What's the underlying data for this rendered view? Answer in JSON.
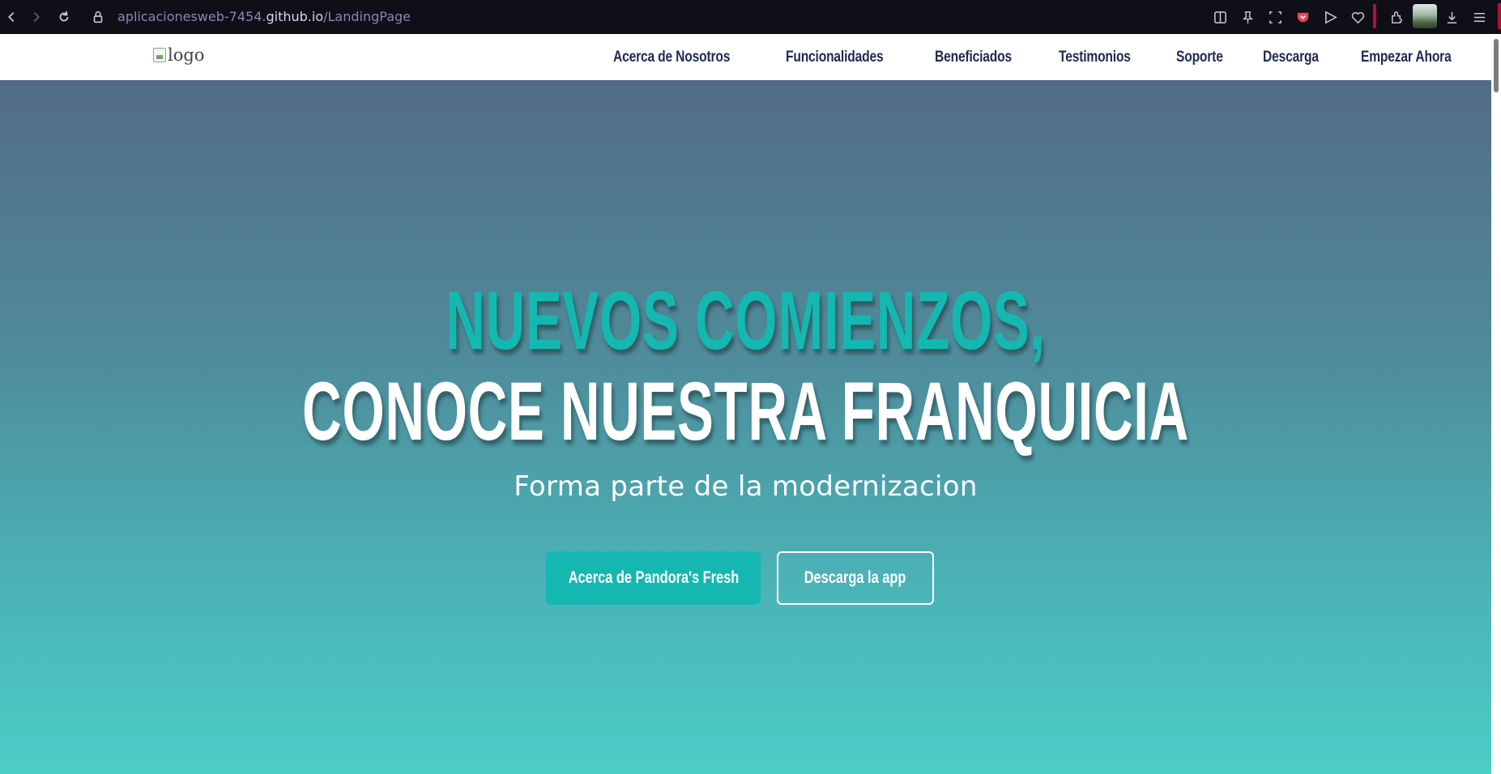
{
  "browser": {
    "url_prefix": "aplicacionesweb-7454.",
    "url_host": "github.io",
    "url_path": "/LandingPage"
  },
  "header": {
    "logo_alt": "logo",
    "nav": [
      "Acerca de Nosotros",
      "Funcionalidades",
      "Beneficiados",
      "Testimonios",
      "Soporte",
      "Descarga",
      "Empezar Ahora"
    ]
  },
  "hero": {
    "line1": "NUEVOS COMIENZOS,",
    "line2": "CONOCE NUESTRA FRANQUICIA",
    "subtitle": "Forma parte de la modernizacion",
    "primary_button": "Acerca de Pandora's Fresh",
    "secondary_button": "Descarga la app"
  },
  "colors": {
    "accent": "#14b8b1",
    "nav_text": "#1e2a52",
    "hero_top": "#536b87",
    "hero_bottom": "#4bcdc6"
  },
  "icons": [
    "back-icon",
    "forward-icon",
    "reload-icon",
    "lock-icon",
    "split-view-icon",
    "pin-icon",
    "screenshot-icon",
    "pocket-icon",
    "send-icon",
    "heart-icon",
    "extensions-icon",
    "download-icon",
    "menu-icon"
  ]
}
